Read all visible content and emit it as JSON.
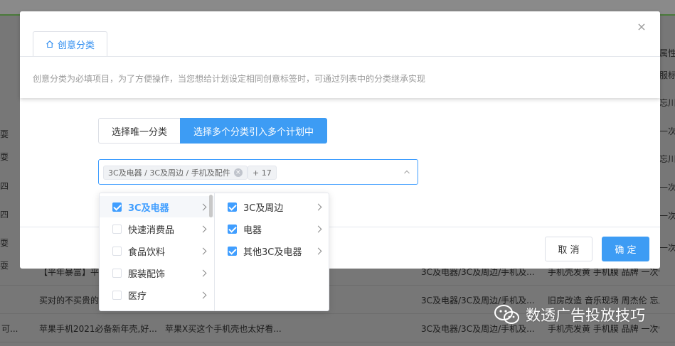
{
  "background": {
    "right_edge": [
      "属性",
      "服标签",
      "忘川修",
      "一次性",
      "忘川修",
      "一次性",
      "一次性",
      "一次性",
      "忘川修",
      "忘川修",
      "一次性"
    ],
    "left_edge": [
      "耍",
      "耍",
      "四",
      "四",
      "耍",
      "耍"
    ],
    "rows": [
      {
        "c1": "【平年暴富】平...",
        "c2": "",
        "c3": "3C及电器/3C及周边/手机及...",
        "c4": "手机壳发黄 手机膜 品牌 一次性"
      },
      {
        "c1": "买对的不买贵的...",
        "c2": "",
        "c3": "3C及电器/3C及周边/手机及...",
        "c4": "旧房改造 音乐现场 周杰伦 忘川修"
      },
      {
        "c0": "可...",
        "c1": "苹果手机2021必备新年壳,好...",
        "c2": "苹果X买这个手机壳也太好看...",
        "c3": "3C及电器/3C及周边/手机及...",
        "c4": "手机壳发黄 手机膜 品牌 一次性"
      }
    ]
  },
  "modal": {
    "tab_label": "创意分类",
    "tab_icon": "home-icon",
    "hint": "创意分类为必填项目，为了方便操作，当您想给计划设定相同创意标签时，可通过列表中的分类继承实现",
    "segment": {
      "single": "选择唯一分类",
      "multi": "选择多个分类引入多个计划中"
    },
    "cascader": {
      "tag": "3C及电器 / 3C及周边 / 手机及配件",
      "more": "+ 17"
    },
    "cancel": "取 消",
    "ok": "确 定"
  },
  "dropdown": {
    "level1": [
      {
        "label": "3C及电器",
        "checked": true,
        "active": true
      },
      {
        "label": "快速消费品",
        "checked": false
      },
      {
        "label": "食品饮料",
        "checked": false
      },
      {
        "label": "服装配饰",
        "checked": false
      },
      {
        "label": "医疗",
        "checked": false
      }
    ],
    "level2": [
      {
        "label": "3C及周边",
        "checked": true
      },
      {
        "label": "电器",
        "checked": true
      },
      {
        "label": "其他3C及电器",
        "checked": true
      }
    ]
  },
  "watermark": {
    "text": "数透广告投放技巧",
    "icon": "wechat-icon"
  }
}
